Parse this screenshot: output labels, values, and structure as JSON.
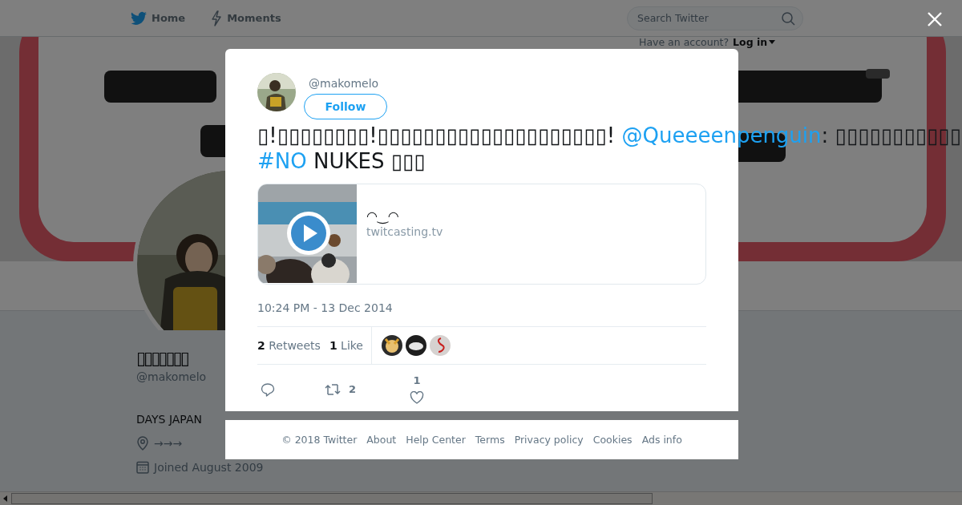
{
  "nav": {
    "items": [
      {
        "label": "Home"
      },
      {
        "label": "Moments"
      }
    ],
    "search": {
      "placeholder": "Search Twitter"
    },
    "account_prompt": "Have an account?",
    "login": "Log in"
  },
  "profile": {
    "name": "▯▯▯▯▯▯▯",
    "handle": "@makomelo",
    "bio": "DAYS JAPAN",
    "location": "→→→",
    "joined": "Joined August 2009"
  },
  "tweet": {
    "handle": "@makomelo",
    "follow": "Follow",
    "lines": [
      [
        {
          "kind": "text",
          "text": "▯!▯▯▯▯▯▯▯▯!▯▯▯▯▯▯▯▯▯▯▯▯▯▯▯▯▯▯▯▯! "
        },
        {
          "kind": "mention",
          "text": "@Queeeenpenguin"
        },
        {
          "kind": "text",
          "text": ": ▯▯▯▯▯▯▯▯▯▯▯"
        }
      ],
      [
        {
          "kind": "hashtag",
          "text": "#NO"
        },
        {
          "kind": "text",
          "text": " NUKES ▯▯▯"
        }
      ]
    ],
    "card": {
      "title": "◠‿◠",
      "domain": "twitcasting.tv"
    },
    "time": "10:24 PM - 13 Dec 2014",
    "stats": [
      {
        "count": "2",
        "label": "Retweets"
      },
      {
        "count": "1",
        "label": "Like"
      }
    ],
    "actions": [
      {
        "kind": "reply"
      },
      {
        "kind": "retweet",
        "count": "2"
      },
      {
        "kind": "like",
        "count": "1"
      }
    ]
  },
  "footer": [
    "© 2018 Twitter",
    "About",
    "Help Center",
    "Terms",
    "Privacy policy",
    "Cookies",
    "Ads info"
  ]
}
